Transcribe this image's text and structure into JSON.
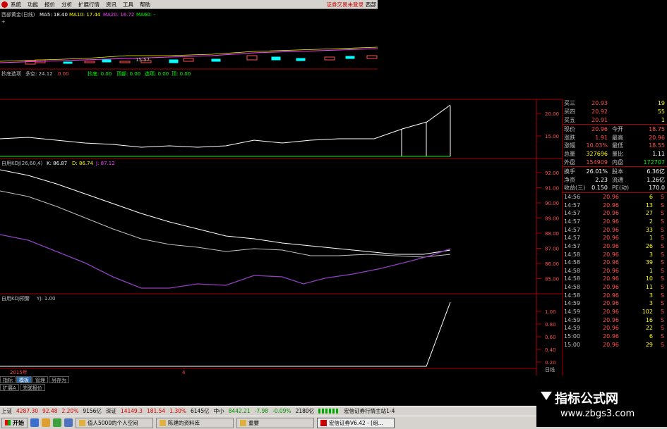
{
  "menu": {
    "items": [
      "系统",
      "功能",
      "报价",
      "分析",
      "扩展行情",
      "资讯",
      "工具",
      "帮助"
    ],
    "right_text": "证券交易未登录",
    "right_text2": "西部"
  },
  "kline_header": {
    "name": "西部黄金(日线)",
    "ma5": "MA5: 18.40",
    "ma10": "MA10: 17.44",
    "ma20": "MA20: 16.72",
    "ma60": "MA60: -",
    "low_label": "15.57"
  },
  "indicator1": {
    "name": "抄底选项",
    "duokong": "多空: 24.12",
    "v1": "0.00",
    "chaodi": "抄底: 0.00",
    "dingbu": "顶部: 0.00",
    "xuanxiang": "选项: 0.00",
    "ding": "顶: 0.00",
    "axis": [
      "20.00",
      "15.00"
    ]
  },
  "kdj": {
    "name": "自用KDJ(26,60,4)",
    "k": "K: 86.87",
    "d": "D: 86.74",
    "j": "J: 87.12",
    "axis": [
      "92.00",
      "91.00",
      "90.00",
      "89.00",
      "88.00",
      "87.00",
      "86.00",
      "85.00"
    ]
  },
  "kdj_alert": {
    "name": "自用KDJ预警",
    "yj": "YJ: 1.00",
    "axis": [
      "1.00",
      "0.80",
      "0.60",
      "0.40",
      "0.20"
    ]
  },
  "year_label": "2015年",
  "year_marker": "4",
  "quote": {
    "asks": [
      {
        "label": "买三",
        "price": "20.93",
        "vol": "19"
      },
      {
        "label": "买四",
        "price": "20.92",
        "vol": "55"
      },
      {
        "label": "买五",
        "price": "20.91",
        "vol": "1"
      }
    ],
    "stats": [
      {
        "l1": "现价",
        "v1": "20.96",
        "l2": "今开",
        "v2": "18.75",
        "c1": "red",
        "c2": "red"
      },
      {
        "l1": "涨跌",
        "v1": "1.91",
        "l2": "最高",
        "v2": "20.96",
        "c1": "red",
        "c2": "red"
      },
      {
        "l1": "涨幅",
        "v1": "10.03%",
        "l2": "最低",
        "v2": "18.55",
        "c1": "red",
        "c2": "red"
      },
      {
        "l1": "总量",
        "v1": "327696",
        "l2": "量比",
        "v2": "1.11",
        "c1": "yellow",
        "c2": "white"
      },
      {
        "l1": "外盘",
        "v1": "154909",
        "l2": "内盘",
        "v2": "172707",
        "c1": "red",
        "c2": "green"
      }
    ],
    "stats2": [
      {
        "l1": "换手",
        "v1": "26.01%",
        "l2": "股本",
        "v2": "6.36亿",
        "c1": "white",
        "c2": "white"
      },
      {
        "l1": "净资",
        "v1": "2.23",
        "l2": "流通",
        "v2": "1.26亿",
        "c1": "white",
        "c2": "white"
      },
      {
        "l1": "收益(三)",
        "v1": "0.150",
        "l2": "PE(动)",
        "v2": "170.0",
        "c1": "white",
        "c2": "white"
      }
    ],
    "ticks": [
      {
        "t": "14:56",
        "p": "20.96",
        "v": "6",
        "s": "S"
      },
      {
        "t": "14:57",
        "p": "20.96",
        "v": "13",
        "s": "S"
      },
      {
        "t": "14:57",
        "p": "20.96",
        "v": "27",
        "s": "S"
      },
      {
        "t": "14:57",
        "p": "20.96",
        "v": "2",
        "s": "S"
      },
      {
        "t": "14:57",
        "p": "20.96",
        "v": "33",
        "s": "S"
      },
      {
        "t": "14:57",
        "p": "20.96",
        "v": "1",
        "s": "S"
      },
      {
        "t": "14:57",
        "p": "20.96",
        "v": "26",
        "s": "S"
      },
      {
        "t": "14:58",
        "p": "20.96",
        "v": "3",
        "s": "S"
      },
      {
        "t": "14:58",
        "p": "20.96",
        "v": "39",
        "s": "S"
      },
      {
        "t": "14:58",
        "p": "20.96",
        "v": "1",
        "s": "S"
      },
      {
        "t": "14:58",
        "p": "20.96",
        "v": "10",
        "s": "S"
      },
      {
        "t": "14:58",
        "p": "20.96",
        "v": "11",
        "s": "S"
      },
      {
        "t": "14:58",
        "p": "20.96",
        "v": "3",
        "s": "S"
      },
      {
        "t": "14:59",
        "p": "20.96",
        "v": "3",
        "s": "S"
      },
      {
        "t": "14:59",
        "p": "20.96",
        "v": "102",
        "s": "S"
      },
      {
        "t": "14:59",
        "p": "20.96",
        "v": "16",
        "s": "S"
      },
      {
        "t": "14:59",
        "p": "20.96",
        "v": "22",
        "s": "S"
      },
      {
        "t": "15:00",
        "p": "20.96",
        "v": "6",
        "s": "S"
      },
      {
        "t": "15:00",
        "p": "20.96",
        "v": "29",
        "s": "S"
      }
    ]
  },
  "bottom_tabs": [
    "指标",
    "模板",
    "管理",
    "另存为"
  ],
  "bottom_tabs2": [
    "扩展A",
    "关联报价"
  ],
  "day_label": "日线",
  "statusbar": [
    {
      "text": "上证",
      "color": "#000"
    },
    {
      "text": "4287.30",
      "color": "#c00"
    },
    {
      "text": "92.48",
      "color": "#c00"
    },
    {
      "text": "2.20%",
      "color": "#c00"
    },
    {
      "text": "9156亿",
      "color": "#000"
    },
    {
      "text": "深证",
      "color": "#000"
    },
    {
      "text": "14149.3",
      "color": "#c00"
    },
    {
      "text": "181.54",
      "color": "#c00"
    },
    {
      "text": "1.30%",
      "color": "#c00"
    },
    {
      "text": "6145亿",
      "color": "#000"
    },
    {
      "text": "中小",
      "color": "#000"
    },
    {
      "text": "8442.21",
      "color": "#080"
    },
    {
      "text": "-7.98",
      "color": "#080"
    },
    {
      "text": "-0.09%",
      "color": "#080"
    },
    {
      "text": "2180亿",
      "color": "#000"
    },
    {
      "text": "宏信证券行情主站1-4",
      "color": "#000"
    }
  ],
  "taskbar": {
    "start": "开始",
    "tasks": [
      "值人5000的个人空间",
      "陈建的资料库",
      "重要",
      "宏信证券V6.42 - [组..."
    ]
  },
  "watermark": {
    "title": "指标公式网",
    "url": "www.zbgs3.com"
  },
  "colors": {
    "kdj_k": "#ffffff",
    "kdj_d": "#c0c0c0",
    "kdj_j": "#9040c0",
    "up": "#ff5050",
    "down": "#00ffff",
    "ma20": "#ff40ff",
    "ma60": "#00ff00"
  }
}
